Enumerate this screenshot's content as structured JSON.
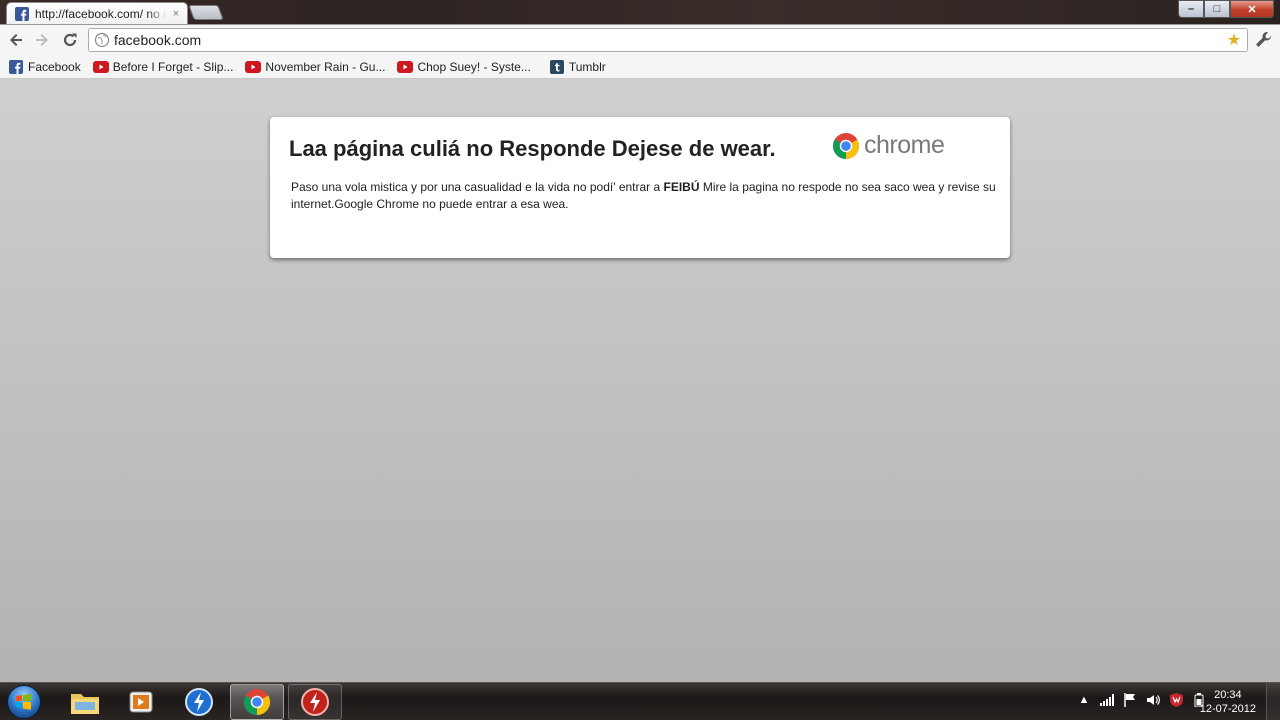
{
  "browser": {
    "tab_title": "http://facebook.com/ no e",
    "tab_close": "×",
    "url": "facebook.com",
    "window_buttons": {
      "minimize": "–",
      "maximize": "□",
      "close": "✕"
    }
  },
  "bookmarks": [
    {
      "label": "Facebook",
      "icon": "facebook-icon"
    },
    {
      "label": "Before I Forget - Slip...",
      "icon": "youtube-icon"
    },
    {
      "label": "November Rain - Gu...",
      "icon": "youtube-icon"
    },
    {
      "label": "Chop Suey! - Syste...",
      "icon": "youtube-icon"
    },
    {
      "label": "Tumblr",
      "icon": "tumblr-icon"
    }
  ],
  "error": {
    "title": "Laa página culiá no Responde Dejese de wear.",
    "brand": "chrome",
    "body_before": "Paso una vola mistica y por una casualidad e la vida no podí' entrar a ",
    "body_bold": "FEIBÚ",
    "body_after": " Mire la pagina no respode no sea saco wea y revise su internet.Google Chrome no puede entrar a esa wea."
  },
  "taskbar": {
    "time": "20:34",
    "date": "12-07-2012",
    "items": [
      "start-button",
      "file-explorer",
      "media-player",
      "downloader",
      "chrome",
      "flash-app"
    ]
  },
  "colors": {
    "content_bg": "#c2c2c2",
    "facebook_blue": "#3b5998",
    "youtube_red": "#cc181e",
    "tumblr_blue": "#2c4762"
  }
}
